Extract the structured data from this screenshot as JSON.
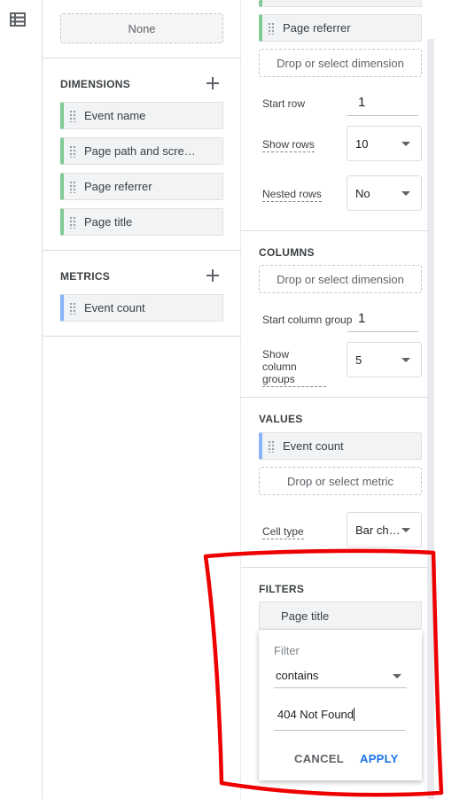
{
  "left_panel": {
    "top_box_label": "None",
    "dimensions": {
      "title": "DIMENSIONS",
      "items": [
        "Event name",
        "Page path and scre…",
        "Page referrer",
        "Page title"
      ]
    },
    "metrics": {
      "title": "METRICS",
      "items": [
        "Event count"
      ]
    }
  },
  "rows_section": {
    "chip": "Page referrer",
    "drop_label": "Drop or select dimension",
    "start_row_label": "Start row",
    "start_row_value": "1",
    "show_rows_label": "Show rows",
    "show_rows_value": "10",
    "nested_rows_label": "Nested rows",
    "nested_rows_value": "No"
  },
  "columns_section": {
    "title": "COLUMNS",
    "drop_label": "Drop or select dimension",
    "start_group_label": "Start column group",
    "start_group_value": "1",
    "show_groups_label_line1": "Show column",
    "show_groups_label_line2": "groups",
    "show_groups_value": "5"
  },
  "values_section": {
    "title": "VALUES",
    "chip": "Event count",
    "drop_label": "Drop or select metric",
    "cell_type_label": "Cell type",
    "cell_type_value": "Bar ch…"
  },
  "filters_section": {
    "title": "FILTERS",
    "chip": "Page title",
    "popup": {
      "label": "Filter",
      "match_type": "contains",
      "value": "404 Not Found",
      "cancel": "CANCEL",
      "apply": "APPLY"
    }
  },
  "colors": {
    "dimension_accent": "#81c995",
    "metric_accent": "#8ab4f8",
    "apply_button": "#1a73e8",
    "annotation": "#ee0000"
  },
  "icons": {
    "rail": "table-icon",
    "add": "plus-icon",
    "drag": "drag-handle-icon",
    "dropdown": "caret-down-icon"
  }
}
